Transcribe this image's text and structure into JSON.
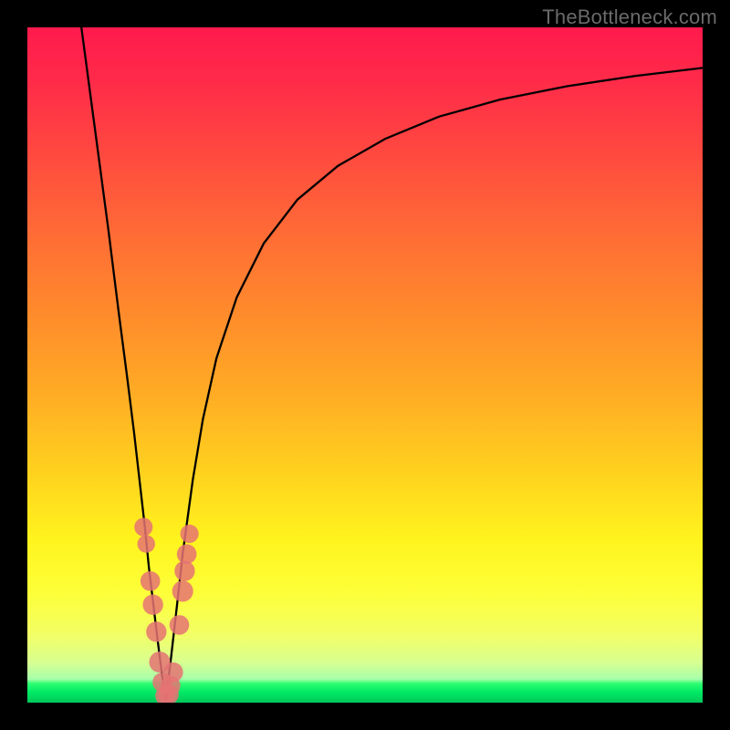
{
  "watermark": "TheBottleneck.com",
  "chart_data": {
    "type": "line",
    "title": "",
    "xlabel": "",
    "ylabel": "",
    "xlim": [
      0,
      100
    ],
    "ylim": [
      0,
      100
    ],
    "grid": false,
    "legend": false,
    "series": [
      {
        "name": "bottleneck-curve-left",
        "x": [
          8.0,
          10.0,
          12.0,
          13.5,
          14.8,
          15.8,
          16.6,
          17.4,
          18.0,
          18.6,
          19.2,
          19.7,
          20.1,
          20.5
        ],
        "values": [
          100.0,
          85.0,
          70.0,
          58.0,
          48.0,
          40.0,
          33.0,
          26.0,
          20.0,
          15.0,
          10.0,
          6.0,
          3.0,
          0.5
        ]
      },
      {
        "name": "bottleneck-curve-right",
        "x": [
          20.5,
          21.2,
          22.0,
          23.0,
          24.5,
          26.0,
          28.0,
          31.0,
          35.0,
          40.0,
          46.0,
          53.0,
          61.0,
          70.0,
          80.0,
          90.0,
          100.0
        ],
        "values": [
          0.5,
          6.0,
          13.0,
          22.0,
          33.0,
          42.0,
          51.0,
          60.0,
          68.0,
          74.5,
          79.5,
          83.5,
          86.8,
          89.3,
          91.3,
          92.8,
          94.0
        ]
      }
    ],
    "scatter": {
      "name": "data-dots",
      "color": "#e57373",
      "points": [
        {
          "x": 17.2,
          "y": 26.0,
          "r": 1.1
        },
        {
          "x": 17.6,
          "y": 23.5,
          "r": 1.0
        },
        {
          "x": 18.2,
          "y": 18.0,
          "r": 1.3
        },
        {
          "x": 18.6,
          "y": 14.5,
          "r": 1.4
        },
        {
          "x": 19.1,
          "y": 10.5,
          "r": 1.4
        },
        {
          "x": 19.6,
          "y": 6.0,
          "r": 1.5
        },
        {
          "x": 20.0,
          "y": 3.0,
          "r": 1.3
        },
        {
          "x": 20.4,
          "y": 1.0,
          "r": 1.3
        },
        {
          "x": 20.9,
          "y": 1.2,
          "r": 1.4
        },
        {
          "x": 21.2,
          "y": 2.5,
          "r": 1.3
        },
        {
          "x": 21.6,
          "y": 4.5,
          "r": 1.3
        },
        {
          "x": 22.5,
          "y": 11.5,
          "r": 1.3
        },
        {
          "x": 23.0,
          "y": 16.5,
          "r": 1.5
        },
        {
          "x": 23.3,
          "y": 19.5,
          "r": 1.4
        },
        {
          "x": 23.6,
          "y": 22.0,
          "r": 1.3
        },
        {
          "x": 24.0,
          "y": 25.0,
          "r": 1.1
        }
      ]
    },
    "background_gradient": {
      "top": "#ff1a4d",
      "mid_upper": "#ff8a2c",
      "mid_lower": "#fff41e",
      "bottom": "#00c85a"
    }
  }
}
